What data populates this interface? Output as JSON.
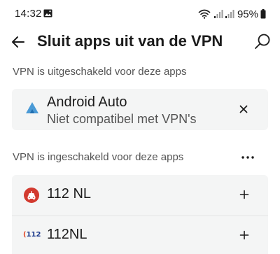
{
  "status_bar": {
    "time": "14:32",
    "battery": "95%",
    "icons": [
      "image-icon",
      "wifi-icon",
      "signal-icon",
      "signal-icon",
      "battery-icon"
    ]
  },
  "header": {
    "title": "Sluit apps uit van de VPN",
    "back_icon": "arrow-left-icon",
    "search_icon": "search-icon"
  },
  "excluded_section": {
    "label": "VPN is uitgeschakeld voor deze apps",
    "apps": [
      {
        "name": "Android Auto",
        "subtitle": "Niet compatibel met VPN's",
        "action": "×",
        "icon": "android-auto-icon"
      }
    ]
  },
  "included_section": {
    "label": "VPN is ingeschakeld voor deze apps",
    "more_icon": "more-horizontal-icon",
    "apps": [
      {
        "name": "112 NL",
        "action": "+",
        "icon": "112-nl-icon"
      },
      {
        "name": "112NL",
        "action": "+",
        "icon_text": "112",
        "icon": "112nl-icon"
      }
    ]
  },
  "colors": {
    "background": "#ffffff",
    "card": "#f4f5f5",
    "secondary_text": "#545454",
    "accent_red": "#d23a2f"
  }
}
